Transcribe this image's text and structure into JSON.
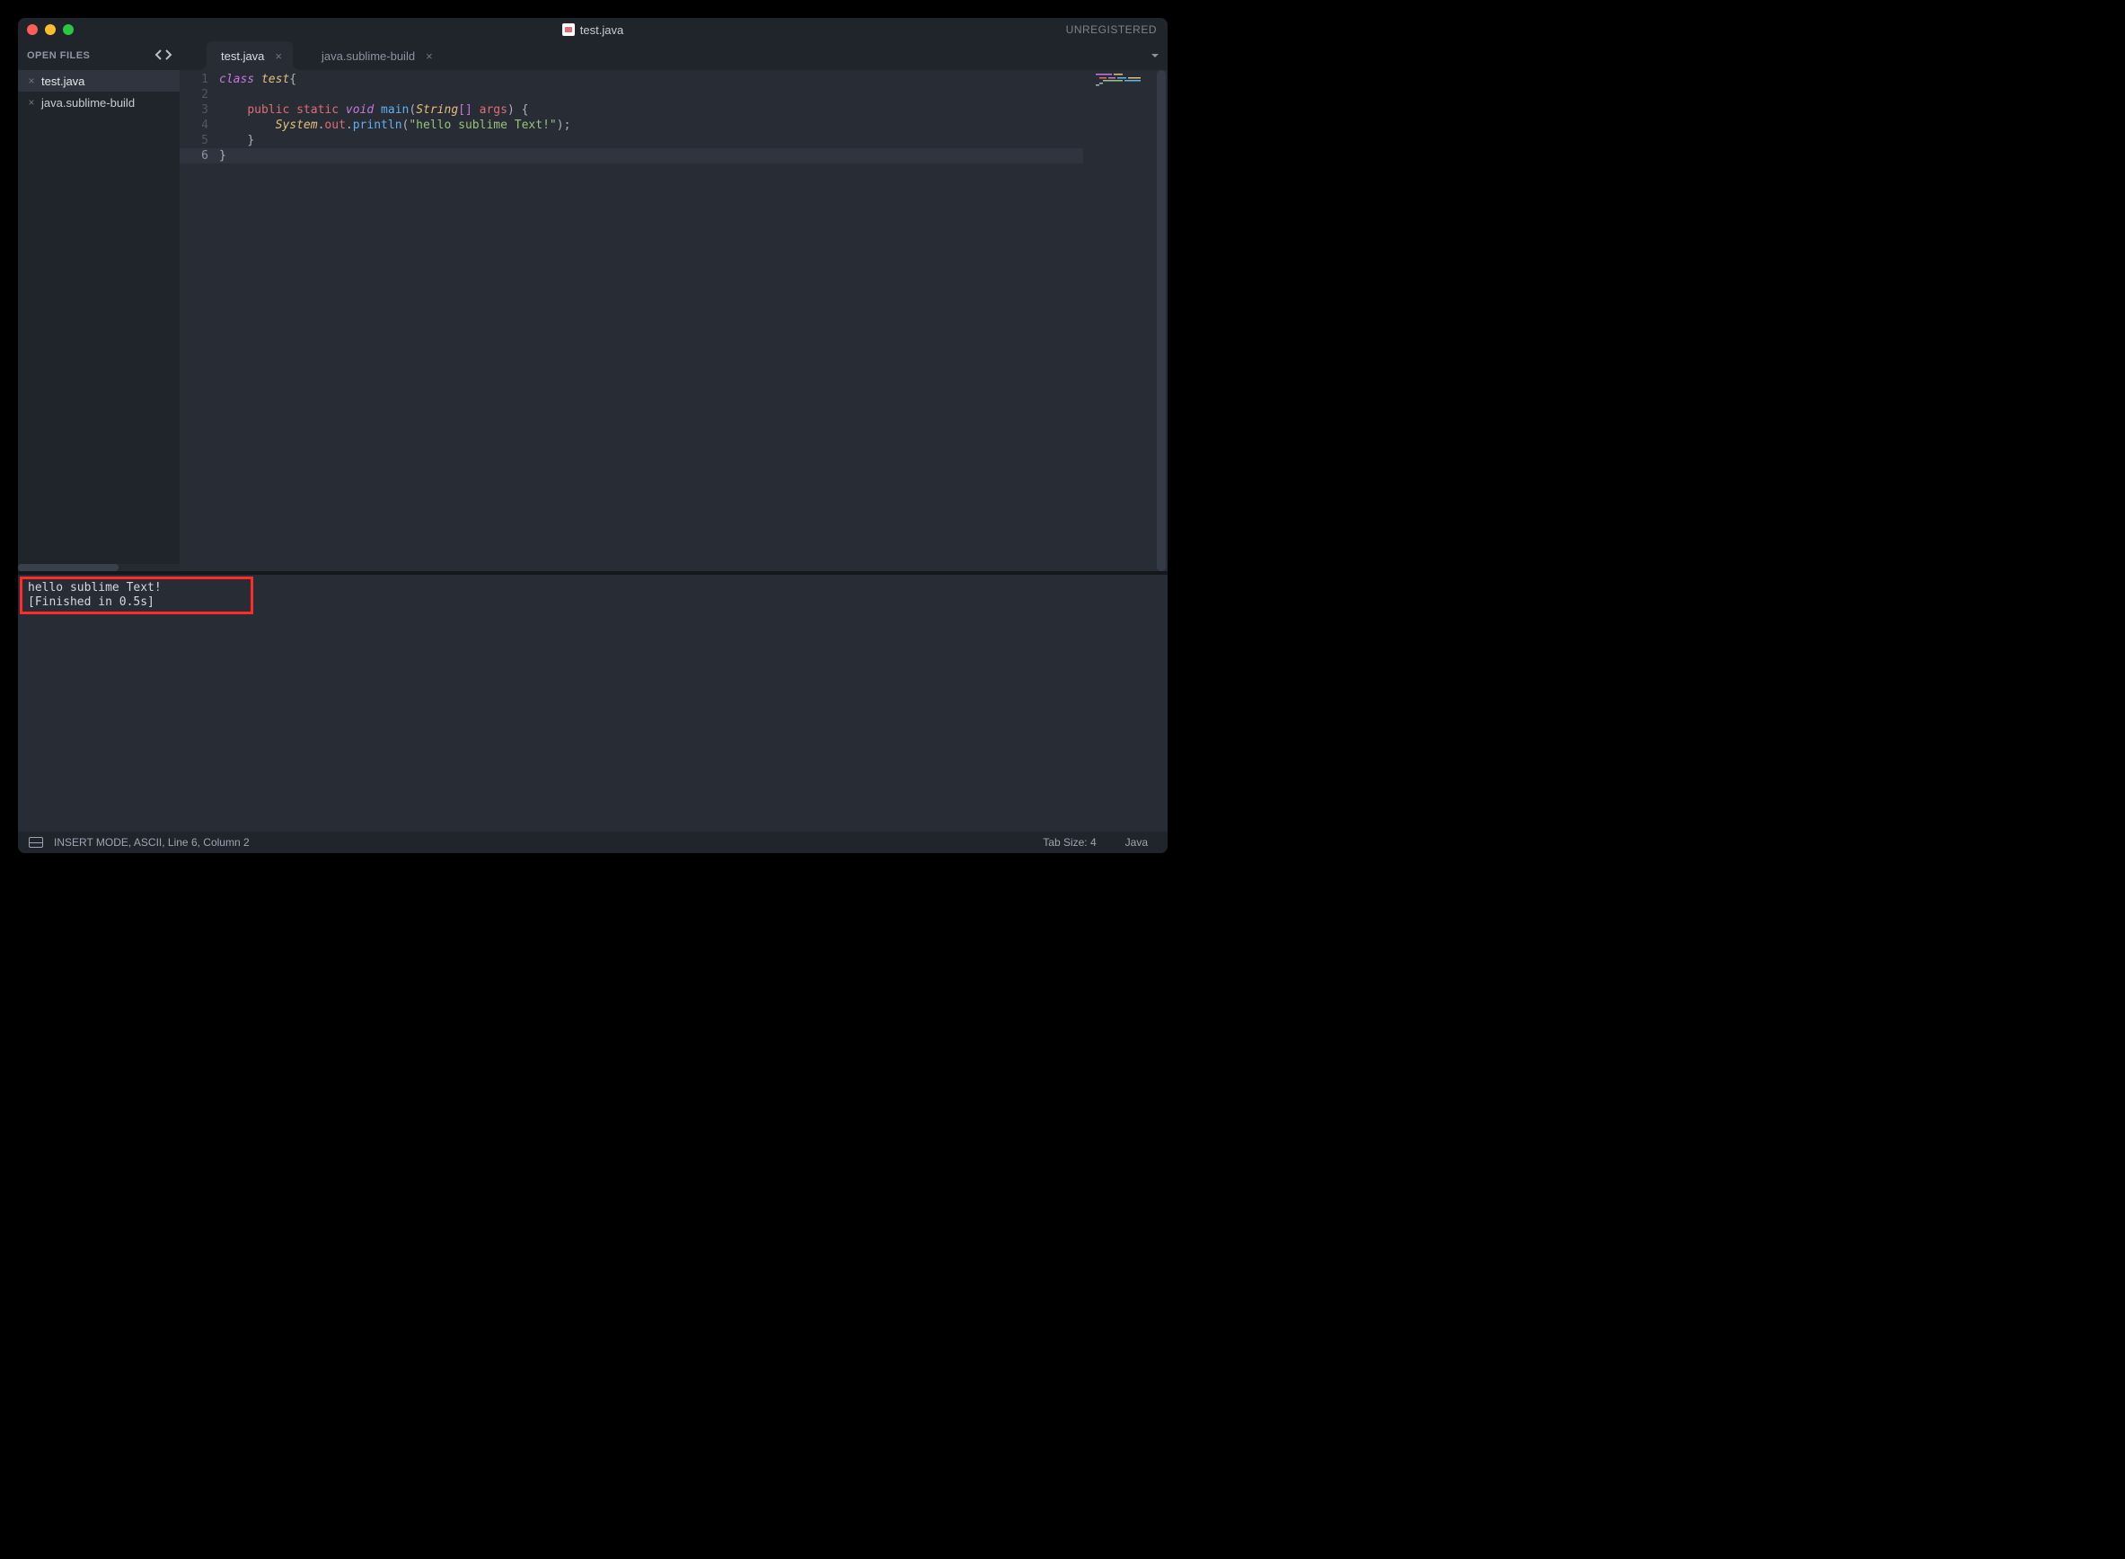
{
  "titlebar": {
    "filename": "test.java",
    "unregistered": "UNREGISTERED"
  },
  "sidebar": {
    "header": "OPEN FILES",
    "items": [
      {
        "name": "test.java",
        "active": true
      },
      {
        "name": "java.sublime-build",
        "active": false
      }
    ]
  },
  "tabs": [
    {
      "label": "test.java",
      "active": true
    },
    {
      "label": "java.sublime-build",
      "active": false
    }
  ],
  "gutter": {
    "lines": [
      "1",
      "2",
      "3",
      "4",
      "5",
      "6"
    ],
    "current": 6
  },
  "code": {
    "l1": {
      "kw_class": "class",
      "cls": "test",
      "brace": "{"
    },
    "l3": {
      "indent": "    ",
      "kw_public": "public",
      "kw_static": "static",
      "kw_void": "void",
      "fn": "main",
      "lp": "(",
      "type": "String",
      "br_open": "[",
      "br_close": "]",
      "sp": " ",
      "arg": "args",
      "rp": ")",
      "ob": " {"
    },
    "l4": {
      "indent": "        ",
      "sys": "System",
      "dot1": ".",
      "out": "out",
      "dot2": ".",
      "println": "println",
      "lp": "(",
      "str": "\"hello sublime Text!\"",
      "rp": ")",
      "semi": ";"
    },
    "l5": {
      "indent": "    ",
      "brace": "}"
    },
    "l6": {
      "brace": "}"
    }
  },
  "output": {
    "line1": "hello sublime Text!",
    "line2": "[Finished in 0.5s]"
  },
  "statusbar": {
    "left": "INSERT MODE, ASCII, Line 6, Column 2",
    "tabsize": "Tab Size: 4",
    "lang": "Java"
  }
}
